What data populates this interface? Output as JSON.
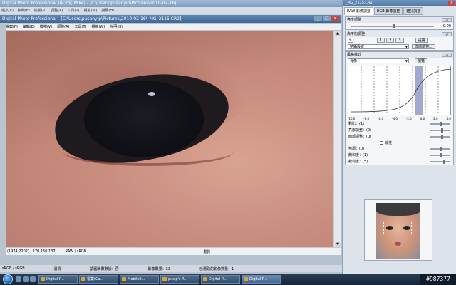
{
  "main_window": {
    "title": "Digital Photo Professional (中文化:Mike) - [C:\\Users\\pusanyip\\Pictures\\2010-02-16]",
    "menu": [
      "檔案(F)",
      "編輯(E)",
      "檢視(V)",
      "調整(A)",
      "工具(T)",
      "視窗(W)",
      "說明(H)"
    ]
  },
  "inner_window": {
    "title": "Digital Photo Professional - [C:\\Users\\pusanyip\\Pictures\\2010-02-16\\_MG_2115.CR2]",
    "menu": [
      "檔案(F)",
      "編輯(E)",
      "檢視(V)",
      "調整(A)",
      "工具(T)",
      "視窗(W)",
      "說明(H)"
    ],
    "status": {
      "coords": "(1974,2202) : 170,150,137",
      "format": "RAW / sRGB",
      "quality": "畫質"
    }
  },
  "main_status": [
    "sRGB / sRGB",
    "畫質",
    "調圖參數數據：否",
    "影像數量：33",
    "已選取的影像數量：1"
  ],
  "palette": {
    "title": "_MG_2115.CR2",
    "tabs": [
      "RAW 影像調整",
      "RGB 影像調整",
      "雜訊調整"
    ],
    "brightness": {
      "label": "亮度調整",
      "value": "0.00",
      "level": 0.5
    },
    "white_balance": {
      "label": "白平衡調整",
      "buttons": [
        "1",
        "2",
        "3"
      ],
      "register": "註冊",
      "mode": "拍攝設定",
      "fine_tune": "微調調整..."
    },
    "picture_style": {
      "label": "風格樣式",
      "selected": "肖像",
      "browse": "瀏覽",
      "tick_labels": [
        "-10.0",
        "-8.0",
        "-6.0",
        "-4.0",
        "-2.0",
        "0.0",
        "2.0",
        "4.0"
      ],
      "rows": [
        {
          "label": "對比：(1)",
          "level": 0.5
        },
        {
          "label": "亮部調整：(0)",
          "level": 0.55
        },
        {
          "label": "暗部調整：(0)",
          "level": 0.55
        }
      ],
      "linear": "線性",
      "color_rows": [
        {
          "label": "色調：(0)",
          "level": 0.5
        },
        {
          "label": "飽和度：(1)",
          "level": 0.45
        },
        {
          "label": "銳利度：(5)",
          "level": 0.65
        }
      ]
    }
  },
  "taskbar": {
    "tasks": [
      "Digital P...",
      "檔案(Ca...",
      "Mobile0...",
      "pusip's R...",
      "Digital P...",
      "Digital P..."
    ],
    "tray": "#987377"
  }
}
